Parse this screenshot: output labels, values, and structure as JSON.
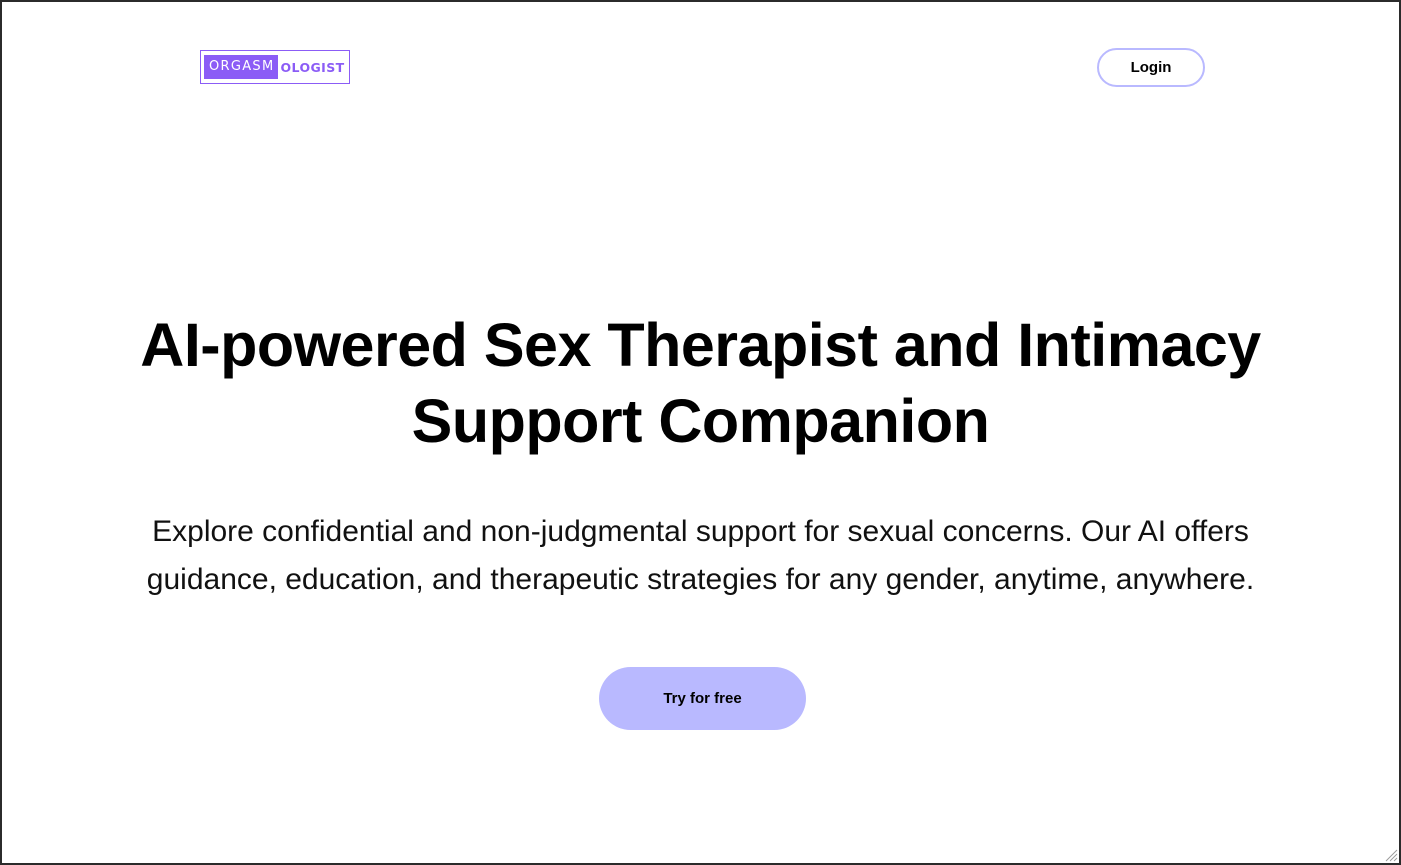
{
  "header": {
    "logo": {
      "part_left": "ORGASM",
      "part_right": "OLOGIST"
    },
    "login_label": "Login"
  },
  "hero": {
    "title_line1": "AI-powered Sex Therapist and Intimacy",
    "title_line2": "Support Companion",
    "subtitle_line1": "Explore confidential and non-judgmental support for sexual concerns. Our AI offers",
    "subtitle_line2": "guidance, education, and therapeutic strategies for any gender, anytime, anywhere.",
    "cta_label": "Try for free"
  },
  "colors": {
    "brand_purple": "#8b5cf6",
    "button_lavender": "#b9b9ff",
    "frame_border": "#2b2b2b"
  },
  "icons": {
    "resize_grip": "resize-grip-icon"
  }
}
